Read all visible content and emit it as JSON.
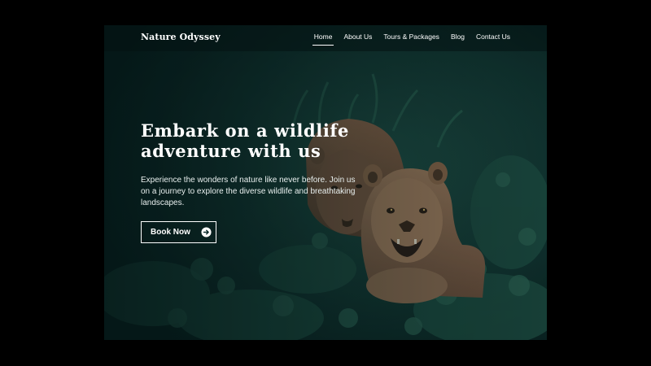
{
  "nav": {
    "brand": "Nature Odyssey",
    "links": [
      {
        "label": "Home",
        "active": true
      },
      {
        "label": "About Us",
        "active": false
      },
      {
        "label": "Tours & Packages",
        "active": false
      },
      {
        "label": "Blog",
        "active": false
      },
      {
        "label": "Contact Us",
        "active": false
      }
    ]
  },
  "hero": {
    "title": "Embark on a wildlife adventure with us",
    "description": "Experience the wonders of nature like never before. Join us on a journey to explore the diverse wildlife and breathtaking landscapes.",
    "cta_label": "Book Now",
    "cta_icon": "arrow-right-circle-icon",
    "background_image": "two lionesses in green foliage"
  },
  "colors": {
    "page_background": "#000000",
    "hero_tint": "#0b2a2a",
    "text": "#ffffff"
  }
}
